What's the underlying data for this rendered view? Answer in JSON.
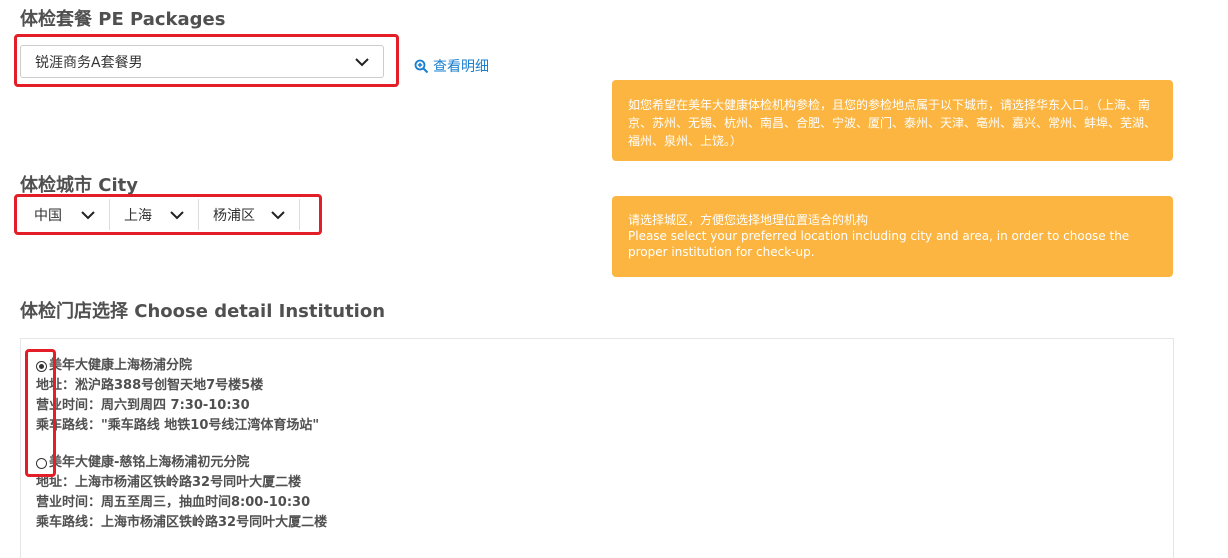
{
  "package_section": {
    "heading": "体检套餐 PE Packages",
    "selected": "锐涯商务A套餐男",
    "detail_link": "查看明细"
  },
  "notice_top": "如您希望在美年大健康体检机构参检，且您的参检地点属于以下城市，请选择华东入口。（上海、南京、苏州、无锡、杭州、南昌、合肥、宁波、厦门、泰州、天津、亳州、嘉兴、常州、蚌埠、芜湖、福州、泉州、上饶。）",
  "city_section": {
    "heading": "体检城市 City",
    "country": "中国",
    "province": "上海",
    "district": "杨浦区"
  },
  "notice_city": {
    "zh": "请选择城区，方便您选择地理位置适合的机构",
    "en": "Please select your preferred location including city and area, in order to choose the proper institution for check-up."
  },
  "institution_section": {
    "heading": "体检门店选择 Choose detail Institution",
    "items": [
      {
        "selected": true,
        "name": "美年大健康上海杨浦分院",
        "address": "地址：淞沪路388号创智天地7号楼5楼",
        "hours": "营业时间：周六到周四 7:30-10:30",
        "route": "乘车路线：\"乘车路线 地铁10号线江湾体育场站\""
      },
      {
        "selected": false,
        "name": "美年大健康-慈铭上海杨浦初元分院",
        "address": "地址：上海市杨浦区铁岭路32号同叶大厦二楼",
        "hours": "营业时间：周五至周三，抽血时间8:00-10:30",
        "route": "乘车路线：上海市杨浦区铁岭路32号同叶大厦二楼"
      }
    ]
  },
  "colors": {
    "highlight_box": "#e31e26",
    "notice_bg": "#fbb540",
    "link": "#1a7fcf"
  }
}
